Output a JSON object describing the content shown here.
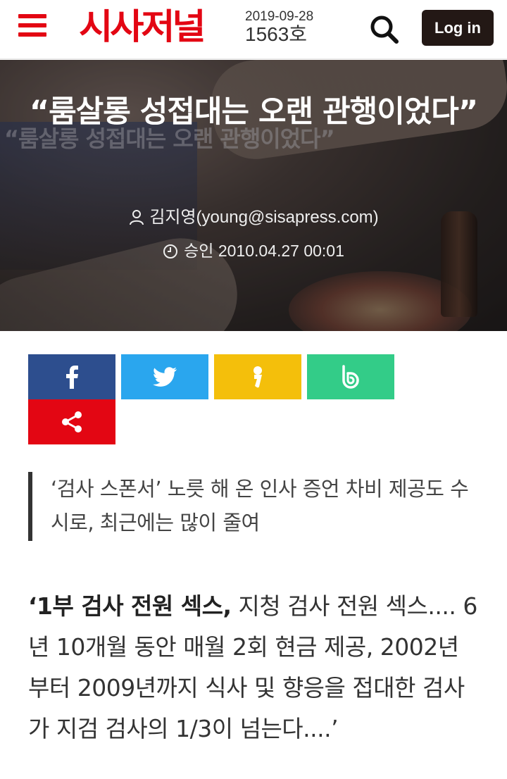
{
  "header": {
    "logo_text": "시사저널",
    "issue_date": "2019-09-28",
    "issue_number": "1563호",
    "login_label": "Log in",
    "menu_icon": "menu-icon",
    "search_icon": "search-icon"
  },
  "colors": {
    "brand_red": "#e30613",
    "login_bg": "#231815",
    "facebook": "#2d4e8e",
    "twitter": "#2aa6ee",
    "kakao": "#f4bf0b",
    "band": "#33cc88",
    "share_more": "#e30613"
  },
  "article": {
    "title": "“룸살롱 성접대는 오랜 관행이었다”",
    "author": "김지영(young@sisapress.com)",
    "approved": "승인 2010.04.27 00:01",
    "subtitle": "‘검사 스폰서’ 노릇 해 온 인사 증언 차비 제공도 수시로, 최근에는 많이 줄여",
    "body_bold": "‘1부 검사 전원 섹스,",
    "body_rest": " 지청 검사 전원 섹스.... 6년 10개월 동안 매월 2회 현금 제공, 2002년부터 2009년까지 식사 및 향응을 접대한 검사가 지검 검사의 1/3이 넘는다....’",
    "hero_cover_text": "“룸살롱 성접대는 오랜 관행이었다”"
  },
  "share": {
    "icons": [
      "facebook-icon",
      "twitter-icon",
      "kakaostory-icon",
      "band-icon",
      "share-icon"
    ]
  }
}
